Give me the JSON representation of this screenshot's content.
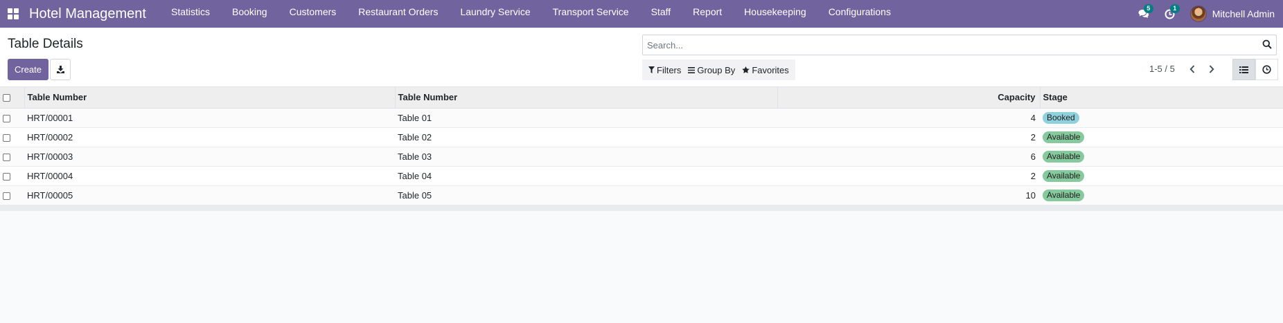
{
  "app": {
    "name": "Hotel Management"
  },
  "menu": [
    "Statistics",
    "Booking",
    "Customers",
    "Restaurant Orders",
    "Laundry Service",
    "Transport Service",
    "Staff",
    "Report",
    "Housekeeping",
    "Configurations"
  ],
  "systray": {
    "messages_count": "5",
    "activities_count": "1",
    "user_name": "Mitchell Admin"
  },
  "page": {
    "title": "Table Details",
    "create_label": "Create"
  },
  "search": {
    "placeholder": "Search..."
  },
  "filters": {
    "filters_label": "Filters",
    "groupby_label": "Group By",
    "favorites_label": "Favorites"
  },
  "pager": {
    "range": "1-5 / 5"
  },
  "table": {
    "headers": [
      "Table Number",
      "Table Number",
      "Capacity",
      "Stage"
    ],
    "rows": [
      {
        "ref": "HRT/00001",
        "name": "Table 01",
        "capacity": "4",
        "stage": "Booked"
      },
      {
        "ref": "HRT/00002",
        "name": "Table 02",
        "capacity": "2",
        "stage": "Available"
      },
      {
        "ref": "HRT/00003",
        "name": "Table 03",
        "capacity": "6",
        "stage": "Available"
      },
      {
        "ref": "HRT/00004",
        "name": "Table 04",
        "capacity": "2",
        "stage": "Available"
      },
      {
        "ref": "HRT/00005",
        "name": "Table 05",
        "capacity": "10",
        "stage": "Available"
      }
    ]
  },
  "colors": {
    "brand": "#71639e",
    "badge": "#017e84",
    "booked": "#8fd0dd",
    "available": "#86c99c"
  }
}
